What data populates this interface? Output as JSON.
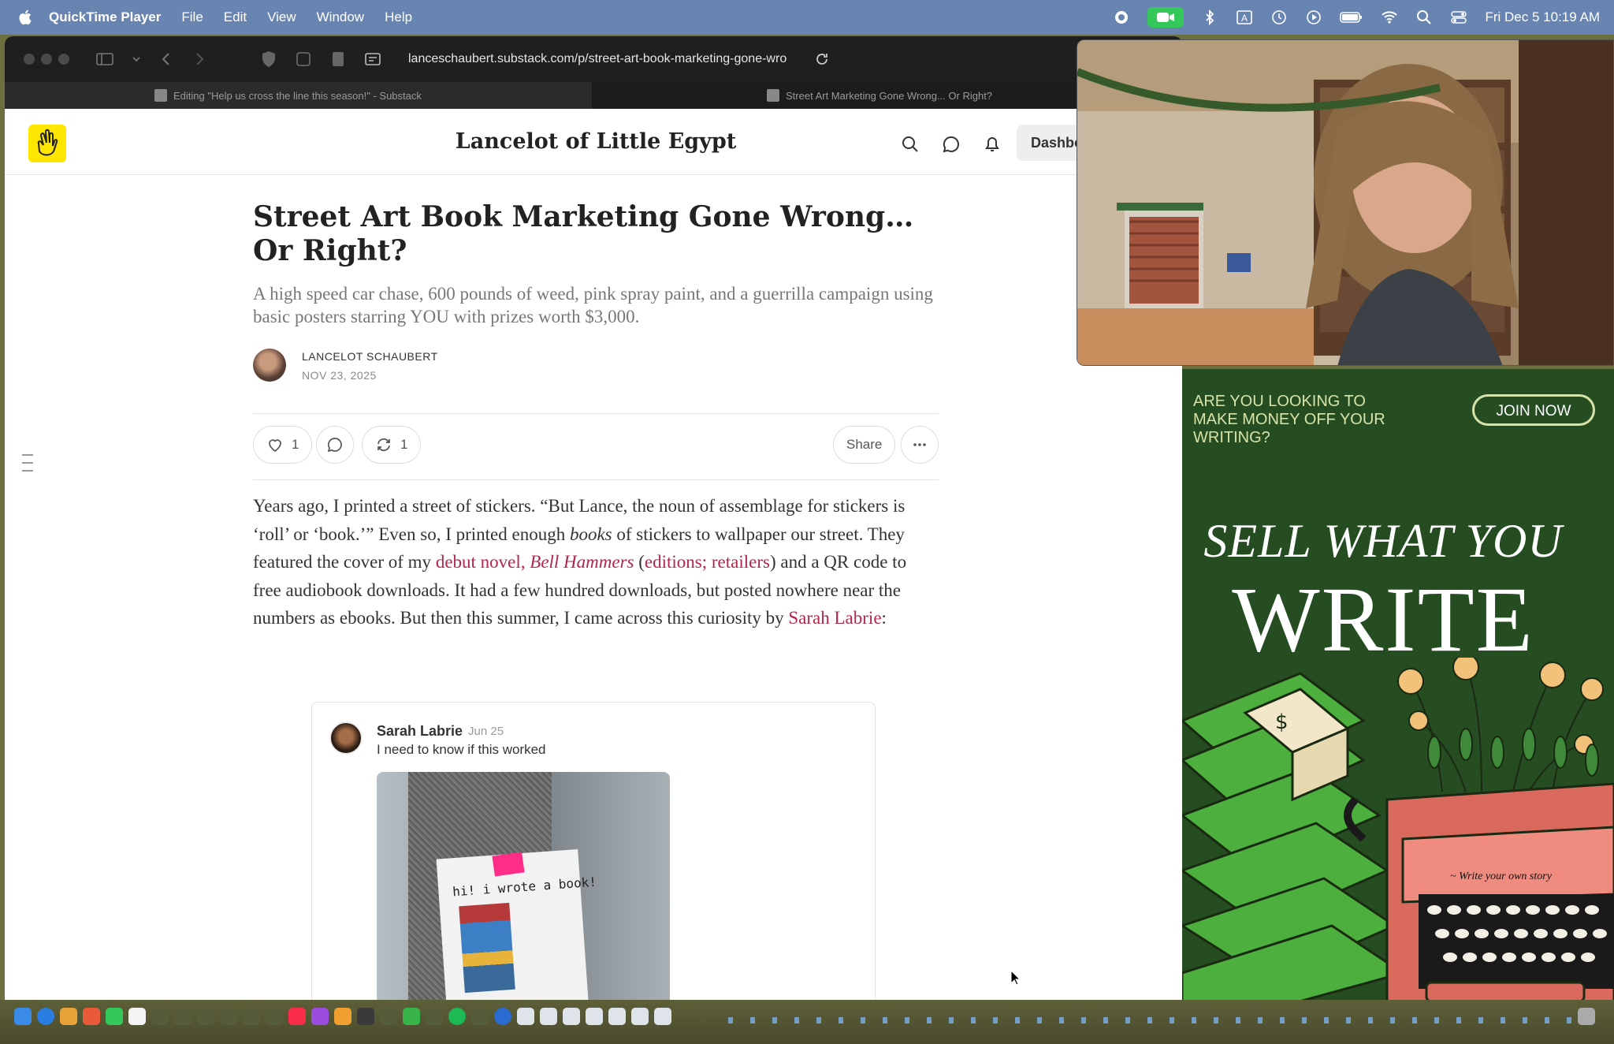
{
  "menubar": {
    "app_name": "QuickTime Player",
    "menus": [
      "File",
      "Edit",
      "View",
      "Window",
      "Help"
    ],
    "clock": "Fri Dec 5  10:19 AM"
  },
  "browser": {
    "address": "lanceschaubert.substack.com/p/street-art-book-marketing-gone-wro",
    "tabs": [
      {
        "label": "Editing \"Help us cross the line this season!\" - Substack"
      },
      {
        "label": "Street Art Marketing Gone Wrong... Or Right?"
      }
    ]
  },
  "site": {
    "title": "Lancelot of Little Egypt",
    "dashboard_label": "Dashbo"
  },
  "article": {
    "title": "Street Art Book Marketing Gone Wrong… Or Right?",
    "subtitle": "A high speed car chase, 600 pounds of weed, pink spray paint, and a guerrilla campaign using basic posters starring YOU with prizes worth $3,000.",
    "author": "LANCELOT SCHAUBERT",
    "date": "NOV 23, 2025",
    "likes": "1",
    "restacks": "1",
    "share_label": "Share",
    "body": {
      "p1_a": "Years ago, I printed a street of stickers. “But Lance, the noun of assemblage for stickers is ‘roll’ or ‘book.’” Even so, I printed enough ",
      "p1_books": "books",
      "p1_b": " of stickers to wallpaper our street. They featured the cover of my ",
      "link_novel": "debut novel, ",
      "link_novel_title": "Bell Hammers",
      "paren_open": " (",
      "link_editions": "editions; retailers",
      "paren_close": ")",
      "p1_c": " and a QR code to free audiobook downloads. It had a few hundred downloads, but posted nowhere near the numbers as ebooks. But then this summer, I came across this curiosity by ",
      "link_sarah": "Sarah Labrie",
      "colon": ":"
    },
    "embed": {
      "name": "Sarah Labrie",
      "date": "Jun 25",
      "text": "I need to know if this worked",
      "poster_text": "hi! i wrote a book!"
    }
  },
  "ad": {
    "question": "ARE YOU LOOKING TO MAKE MONEY OFF YOUR WRITING?",
    "join": "JOIN NOW",
    "sell": "SELL WHAT YOU",
    "write": "WRITE",
    "caption": "~ Write your own story"
  }
}
